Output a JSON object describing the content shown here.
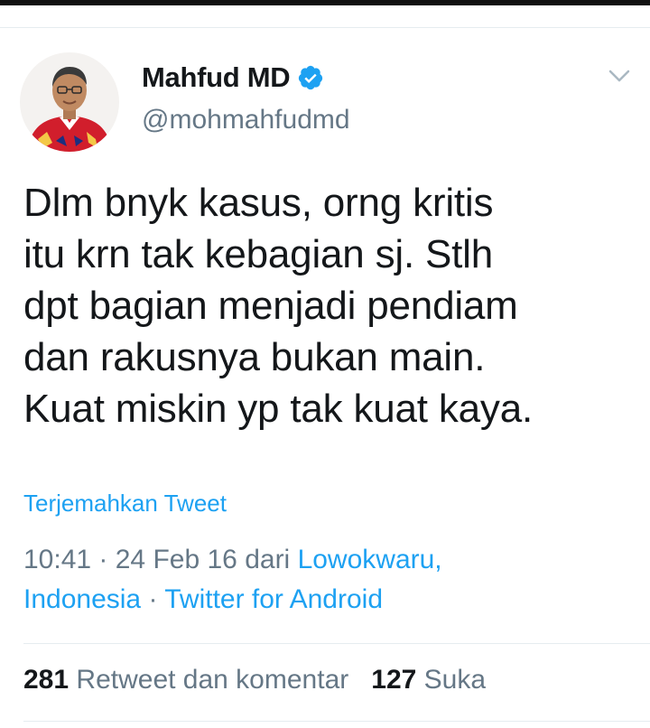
{
  "author": {
    "display_name": "Mahfud MD",
    "handle": "@mohmahfudmd",
    "verified": true
  },
  "icons": {
    "verified": "verified-badge-icon",
    "menu": "chevron-down-icon"
  },
  "tweet": {
    "lines": [
      "Dlm bnyk kasus, orng kritis",
      "itu krn tak kebagian sj. Stlh",
      "dpt bagian menjadi pendiam",
      "dan rakusnya bukan main.",
      "Kuat miskin yp tak kuat kaya."
    ]
  },
  "translate_label": "Terjemahkan Tweet",
  "meta": {
    "time": "10:41",
    "separator": " · ",
    "date": "24 Feb 16",
    "from_label": " dari ",
    "location_line1": "Lowokwaru,",
    "location_line2": "Indonesia",
    "client": "Twitter for Android"
  },
  "stats": {
    "retweets_count": "281",
    "retweets_label": "Retweet dan komentar",
    "likes_count": "127",
    "likes_label": "Suka"
  },
  "colors": {
    "link": "#1da1f2",
    "secondary_text": "#657786",
    "primary_text": "#14171a",
    "divider": "#e6ecf0"
  }
}
